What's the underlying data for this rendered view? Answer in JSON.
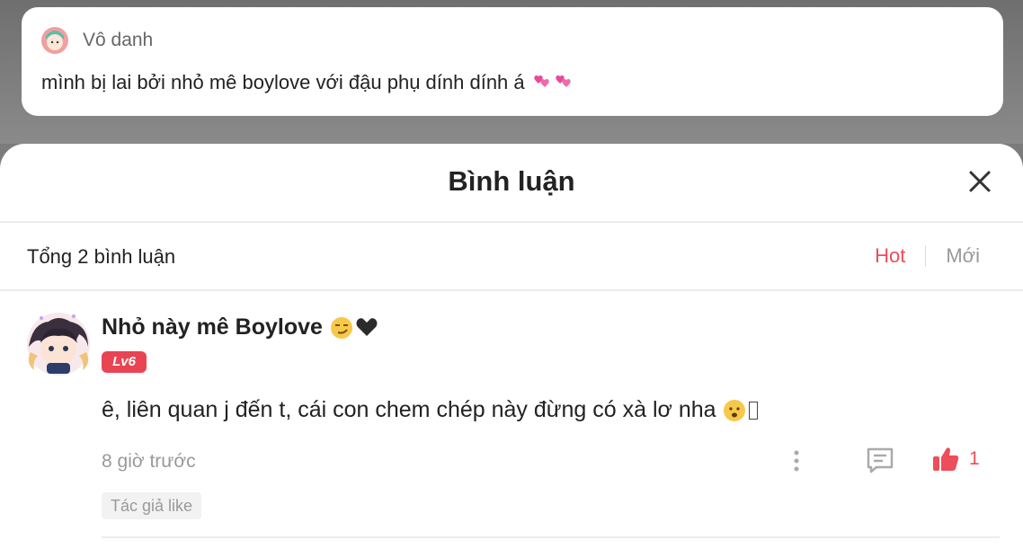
{
  "post": {
    "author": "Vô danh",
    "text": "mình bị lai bởi nhỏ mê boylove với đậu phụ dính dính á"
  },
  "sheet": {
    "title": "Bình luận",
    "total": "Tổng 2 bình luận",
    "sort_hot": "Hot",
    "sort_new": "Mới"
  },
  "comments": [
    {
      "name": "Nhỏ này mê Boylove",
      "level": "Lv6",
      "text": "ê, liên quan j đến t, cái con chem chép này đừng có xà lơ nha",
      "time": "8 giờ trước",
      "likes": "1",
      "tag": "Tác giả like"
    }
  ],
  "colors": {
    "accent": "#ee4d5a",
    "badge": "#e84453"
  },
  "icons": [
    "heart-emoji-icon",
    "close-icon",
    "more-icon",
    "reply-icon",
    "thumbs-up-icon"
  ]
}
